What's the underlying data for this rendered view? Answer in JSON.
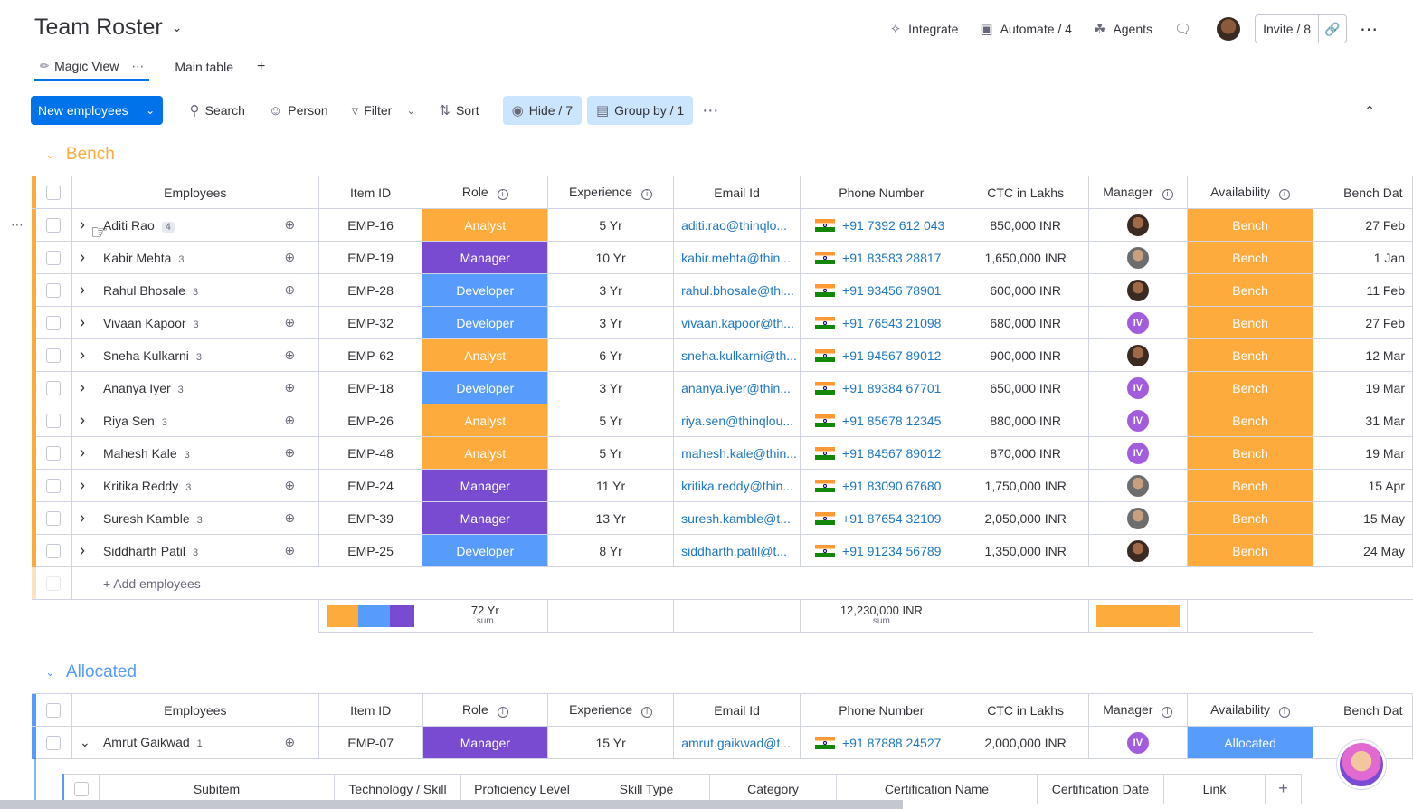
{
  "header": {
    "title": "Team Roster",
    "actions": [
      {
        "label": "Integrate",
        "icon": "integrate-icon"
      },
      {
        "label": "Automate / 4",
        "icon": "robot-icon"
      },
      {
        "label": "Agents",
        "icon": "agents-icon"
      }
    ],
    "invite_label": "Invite / 8"
  },
  "tabs": [
    {
      "label": "Magic View",
      "active": true
    },
    {
      "label": "Main table",
      "active": false
    }
  ],
  "toolbar": {
    "new_label": "New employees",
    "search": "Search",
    "person": "Person",
    "filter": "Filter",
    "sort": "Sort",
    "hide": "Hide / 7",
    "group_by": "Group by / 1"
  },
  "colors": {
    "bench": "#fdab3d",
    "allocated": "#579bfc",
    "analyst": "#fdab3d",
    "manager": "#784bd1",
    "developer": "#579bfc",
    "accent": "#0073ea"
  },
  "columns": [
    "Employees",
    "Item ID",
    "Role",
    "Experience",
    "Email Id",
    "Phone Number",
    "CTC in Lakhs",
    "Manager",
    "Availability",
    "Bench Dat"
  ],
  "groups": [
    {
      "name": "Bench",
      "add_label": "+ Add employees",
      "rows": [
        {
          "name": "Aditi Rao",
          "count": "4",
          "id": "EMP-16",
          "role": "Analyst",
          "exp": "5 Yr",
          "email": "aditi.rao@thinqlo...",
          "phone": "+91 7392 612 043",
          "ctc": "850,000 INR",
          "mgr": "photo1",
          "avail": "Bench",
          "date": "27 Feb"
        },
        {
          "name": "Kabir Mehta",
          "count": "3",
          "id": "EMP-19",
          "role": "Manager",
          "exp": "10 Yr",
          "email": "kabir.mehta@thin...",
          "phone": "+91 83583 28817",
          "ctc": "1,650,000 INR",
          "mgr": "photo2",
          "avail": "Bench",
          "date": "1 Jan"
        },
        {
          "name": "Rahul Bhosale",
          "count": "3",
          "id": "EMP-28",
          "role": "Developer",
          "exp": "3 Yr",
          "email": "rahul.bhosale@thi...",
          "phone": "+91 93456 78901",
          "ctc": "600,000 INR",
          "mgr": "photo1",
          "avail": "Bench",
          "date": "11 Feb"
        },
        {
          "name": "Vivaan Kapoor",
          "count": "3",
          "id": "EMP-32",
          "role": "Developer",
          "exp": "3 Yr",
          "email": "vivaan.kapoor@th...",
          "phone": "+91 76543 21098",
          "ctc": "680,000 INR",
          "mgr": "IV",
          "avail": "Bench",
          "date": "27 Feb"
        },
        {
          "name": "Sneha Kulkarni",
          "count": "3",
          "id": "EMP-62",
          "role": "Analyst",
          "exp": "6 Yr",
          "email": "sneha.kulkarni@th...",
          "phone": "+91 94567 89012",
          "ctc": "900,000 INR",
          "mgr": "photo1",
          "avail": "Bench",
          "date": "12 Mar"
        },
        {
          "name": "Ananya Iyer",
          "count": "3",
          "id": "EMP-18",
          "role": "Developer",
          "exp": "3 Yr",
          "email": "ananya.iyer@thin...",
          "phone": "+91 89384 67701",
          "ctc": "650,000 INR",
          "mgr": "IV",
          "avail": "Bench",
          "date": "19 Mar"
        },
        {
          "name": "Riya Sen",
          "count": "3",
          "id": "EMP-26",
          "role": "Analyst",
          "exp": "5 Yr",
          "email": "riya.sen@thinqlou...",
          "phone": "+91 85678 12345",
          "ctc": "880,000 INR",
          "mgr": "IV",
          "avail": "Bench",
          "date": "31 Mar"
        },
        {
          "name": "Mahesh Kale",
          "count": "3",
          "id": "EMP-48",
          "role": "Analyst",
          "exp": "5 Yr",
          "email": "mahesh.kale@thin...",
          "phone": "+91 84567 89012",
          "ctc": "870,000 INR",
          "mgr": "IV",
          "avail": "Bench",
          "date": "19 Mar"
        },
        {
          "name": "Kritika Reddy",
          "count": "3",
          "id": "EMP-24",
          "role": "Manager",
          "exp": "11 Yr",
          "email": "kritika.reddy@thin...",
          "phone": "+91 83090 67680",
          "ctc": "1,750,000 INR",
          "mgr": "photo2",
          "avail": "Bench",
          "date": "15 Apr"
        },
        {
          "name": "Suresh Kamble",
          "count": "3",
          "id": "EMP-39",
          "role": "Manager",
          "exp": "13 Yr",
          "email": "suresh.kamble@t...",
          "phone": "+91 87654 32109",
          "ctc": "2,050,000 INR",
          "mgr": "photo2",
          "avail": "Bench",
          "date": "15 May"
        },
        {
          "name": "Siddharth Patil",
          "count": "3",
          "id": "EMP-25",
          "role": "Developer",
          "exp": "8 Yr",
          "email": "siddharth.patil@t...",
          "phone": "+91 91234 56789",
          "ctc": "1,350,000 INR",
          "mgr": "photo1",
          "avail": "Bench",
          "date": "24 May"
        }
      ],
      "summary": {
        "exp": "72 Yr",
        "exp_sub": "sum",
        "ctc": "12,230,000 INR",
        "ctc_sub": "sum",
        "role_split": [
          0.36,
          0.36,
          0.28
        ]
      }
    },
    {
      "name": "Allocated",
      "rows": [
        {
          "name": "Amrut Gaikwad",
          "count": "1",
          "id": "EMP-07",
          "role": "Manager",
          "exp": "15 Yr",
          "email": "amrut.gaikwad@t...",
          "phone": "+91 87888 24527",
          "ctc": "2,000,000 INR",
          "mgr": "IV",
          "avail": "Allocated",
          "date": ""
        }
      ]
    }
  ],
  "subitem_columns": [
    "Subitem",
    "Technology / Skill",
    "Proficiency Level",
    "Skill Type",
    "Category",
    "Certification Name",
    "Certification Date",
    "Link"
  ]
}
